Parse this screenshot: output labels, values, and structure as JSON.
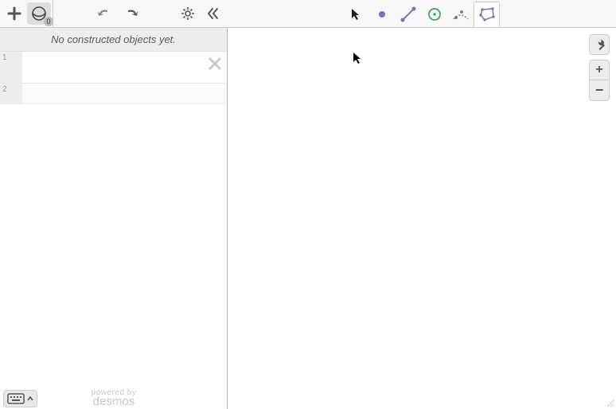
{
  "toolbar": {
    "add_label": "Add",
    "geo_count": "0",
    "undo_label": "Undo",
    "redo_label": "Redo",
    "settings_label": "Settings",
    "collapse_label": "Collapse"
  },
  "construct_tools": {
    "select": "Select",
    "point": "Point",
    "segment": "Segment",
    "circle": "Circle",
    "compass": "Compass",
    "polygon": "Polygon",
    "active": "polygon"
  },
  "sidebar": {
    "empty_message": "No constructed objects yet.",
    "rows": [
      {
        "index": "1"
      },
      {
        "index": "2"
      }
    ]
  },
  "canvas_controls": {
    "wrench": "Graph Settings",
    "zoom_in": "+",
    "zoom_out": "−"
  },
  "footer": {
    "keyboard": "Keyboard",
    "powered": "powered by",
    "brand": "desmos"
  },
  "colors": {
    "purple": "#7b6fc7",
    "green": "#3faa3f"
  }
}
